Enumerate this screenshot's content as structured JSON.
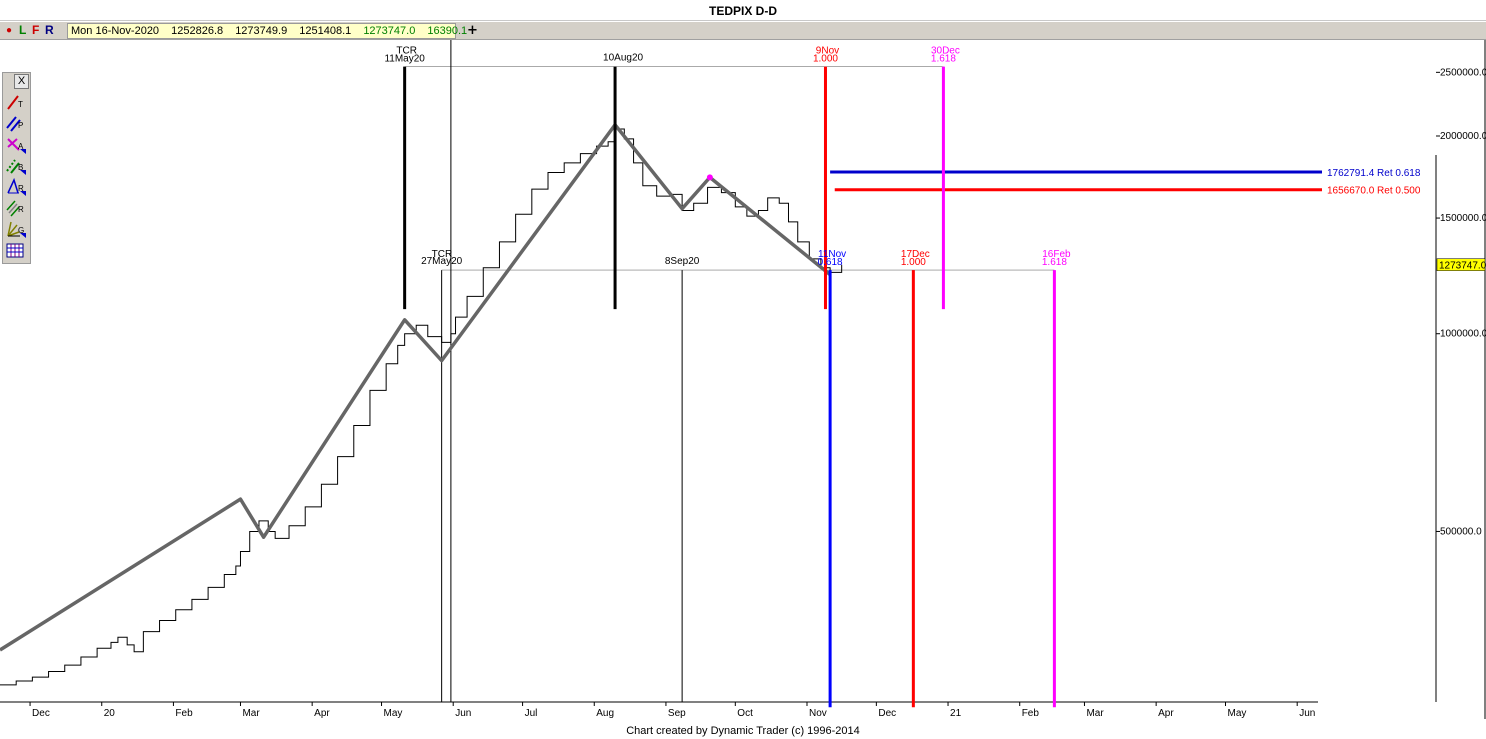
{
  "window": {
    "title": "TEDPIX D-D"
  },
  "toolbar": {
    "toggles": [
      {
        "label": "●",
        "color": "#cc0000"
      },
      {
        "label": "L",
        "color": "#008000"
      },
      {
        "label": "F",
        "color": "#cc0000"
      },
      {
        "label": "R",
        "color": "#000080"
      }
    ],
    "quote": {
      "date": "Mon 16-Nov-2020",
      "open": "1252826.8",
      "high": "1273749.9",
      "low": "1251408.1",
      "close": "1273747.0",
      "change": "16390.1"
    },
    "add_label": "+"
  },
  "toolbox": {
    "close_label": "X",
    "tools": [
      {
        "name": "trendline-tool-icon",
        "letter": "T",
        "color": "#cc0000"
      },
      {
        "name": "parallel-tool-icon",
        "letter": "P",
        "color": "#0000cc"
      },
      {
        "name": "alternate-price-projection-icon",
        "letter": "A",
        "color": "#cc00cc"
      },
      {
        "name": "price-band-tool-icon",
        "letter": "B",
        "color": "#008000"
      },
      {
        "name": "retracement-tool-icon",
        "letter": "R",
        "color": "#0000cc"
      },
      {
        "name": "ratio-tool-icon",
        "letter": "R",
        "color": "#008000"
      },
      {
        "name": "gann-tool-icon",
        "letter": "G",
        "color": "#808000"
      },
      {
        "name": "grid-tool-icon",
        "letter": "",
        "color": "#800080"
      }
    ]
  },
  "footer": {
    "credit": "Chart created by Dynamic Trader  (c) 1996-2014"
  },
  "chart_data": {
    "type": "line",
    "title": "TEDPIX D-D",
    "y_scale": "log",
    "ylim": [
      275000,
      2800000
    ],
    "xlim": [
      "2019-11-18",
      "2021-06-10"
    ],
    "grid": false,
    "x_ticks": [
      {
        "label": "Dec",
        "date": "2019-12-01"
      },
      {
        "label": "20",
        "date": "2020-01-01"
      },
      {
        "label": "Feb",
        "date": "2020-02-01"
      },
      {
        "label": "Mar",
        "date": "2020-03-01"
      },
      {
        "label": "Apr",
        "date": "2020-04-01"
      },
      {
        "label": "May",
        "date": "2020-05-01"
      },
      {
        "label": "Jun",
        "date": "2020-06-01"
      },
      {
        "label": "Jul",
        "date": "2020-07-01"
      },
      {
        "label": "Aug",
        "date": "2020-08-01"
      },
      {
        "label": "Sep",
        "date": "2020-09-01"
      },
      {
        "label": "Oct",
        "date": "2020-10-01"
      },
      {
        "label": "Nov",
        "date": "2020-11-01"
      },
      {
        "label": "Dec",
        "date": "2020-12-01"
      },
      {
        "label": "21",
        "date": "2021-01-01"
      },
      {
        "label": "Feb",
        "date": "2021-02-01"
      },
      {
        "label": "Mar",
        "date": "2021-03-01"
      },
      {
        "label": "Apr",
        "date": "2021-04-01"
      },
      {
        "label": "May",
        "date": "2021-05-01"
      },
      {
        "label": "Jun",
        "date": "2021-06-01"
      }
    ],
    "y_ticks": [
      {
        "label": "2500000.0",
        "value": 2500000
      },
      {
        "label": "2000000.0",
        "value": 2000000
      },
      {
        "label": "1500000.0",
        "value": 1500000
      },
      {
        "label": "1000000.0",
        "value": 1000000
      },
      {
        "label": "500000.0",
        "value": 500000
      }
    ],
    "last_price": {
      "label": "1273747.0",
      "value": 1273747
    },
    "series": [
      {
        "style": "step",
        "color": "#000000",
        "points": [
          [
            "2019-11-18",
            292000
          ],
          [
            "2019-11-25",
            296000
          ],
          [
            "2019-12-02",
            300000
          ],
          [
            "2019-12-09",
            306000
          ],
          [
            "2019-12-16",
            313000
          ],
          [
            "2019-12-23",
            322000
          ],
          [
            "2019-12-30",
            332000
          ],
          [
            "2020-01-05",
            339000
          ],
          [
            "2020-01-08",
            345000
          ],
          [
            "2020-01-12",
            336000
          ],
          [
            "2020-01-15",
            328000
          ],
          [
            "2020-01-19",
            352000
          ],
          [
            "2020-01-26",
            366000
          ],
          [
            "2020-02-02",
            380000
          ],
          [
            "2020-02-09",
            394000
          ],
          [
            "2020-02-16",
            411000
          ],
          [
            "2020-02-23",
            430000
          ],
          [
            "2020-02-28",
            443000
          ],
          [
            "2020-03-01",
            466000
          ],
          [
            "2020-03-05",
            500000
          ],
          [
            "2020-03-09",
            519000
          ],
          [
            "2020-03-13",
            500000
          ],
          [
            "2020-03-16",
            488000
          ],
          [
            "2020-03-22",
            510000
          ],
          [
            "2020-03-29",
            545000
          ],
          [
            "2020-04-05",
            590000
          ],
          [
            "2020-04-12",
            650000
          ],
          [
            "2020-04-19",
            725000
          ],
          [
            "2020-04-26",
            820000
          ],
          [
            "2020-05-03",
            900000
          ],
          [
            "2020-05-08",
            960000
          ],
          [
            "2020-05-11",
            1000000
          ],
          [
            "2020-05-16",
            1030000
          ],
          [
            "2020-05-21",
            990000
          ],
          [
            "2020-05-27",
            970000
          ],
          [
            "2020-05-31",
            1000000
          ],
          [
            "2020-06-02",
            1060000
          ],
          [
            "2020-06-07",
            1140000
          ],
          [
            "2020-06-14",
            1260000
          ],
          [
            "2020-06-21",
            1380000
          ],
          [
            "2020-06-28",
            1520000
          ],
          [
            "2020-07-05",
            1660000
          ],
          [
            "2020-07-12",
            1760000
          ],
          [
            "2020-07-19",
            1820000
          ],
          [
            "2020-07-26",
            1880000
          ],
          [
            "2020-08-02",
            1930000
          ],
          [
            "2020-08-07",
            1960000
          ],
          [
            "2020-08-10",
            2050000
          ],
          [
            "2020-08-14",
            1980000
          ],
          [
            "2020-08-18",
            1820000
          ],
          [
            "2020-08-22",
            1680000
          ],
          [
            "2020-08-28",
            1620000
          ],
          [
            "2020-09-03",
            1630000
          ],
          [
            "2020-09-08",
            1540000
          ],
          [
            "2020-09-13",
            1580000
          ],
          [
            "2020-09-19",
            1670000
          ],
          [
            "2020-09-25",
            1640000
          ],
          [
            "2020-10-01",
            1560000
          ],
          [
            "2020-10-06",
            1510000
          ],
          [
            "2020-10-11",
            1540000
          ],
          [
            "2020-10-15",
            1610000
          ],
          [
            "2020-10-20",
            1580000
          ],
          [
            "2020-10-24",
            1480000
          ],
          [
            "2020-10-28",
            1380000
          ],
          [
            "2020-11-02",
            1300000
          ],
          [
            "2020-11-07",
            1260000
          ],
          [
            "2020-11-11",
            1240000
          ],
          [
            "2020-11-16",
            1273747
          ]
        ]
      },
      {
        "style": "swing",
        "color": "#666666",
        "points": [
          [
            "2019-11-18",
            330000
          ],
          [
            "2020-03-01",
            560000
          ],
          [
            "2020-03-11",
            490000
          ],
          [
            "2020-05-11",
            1050000
          ],
          [
            "2020-05-27",
            910000
          ],
          [
            "2020-08-10",
            2080000
          ],
          [
            "2020-09-08",
            1550000
          ],
          [
            "2020-09-20",
            1730000
          ],
          [
            "2020-11-11",
            1230000
          ]
        ]
      }
    ],
    "annotations": {
      "vertical_bars": [
        {
          "date": "2020-05-11",
          "top": 2550000,
          "bottom": 1090000,
          "color": "#000000",
          "lines": [
            "TCR",
            "11May20"
          ]
        },
        {
          "date": "2020-08-10",
          "top": 2550000,
          "bottom": 1090000,
          "color": "#000000",
          "lines": [
            "10Aug20"
          ]
        },
        {
          "date": "2020-11-09",
          "top": 2550000,
          "bottom": 1090000,
          "color": "#ff0000",
          "lines": [
            "9Nov",
            "1.000"
          ]
        },
        {
          "date": "2020-12-30",
          "top": 2550000,
          "bottom": 1090000,
          "color": "#ff00ff",
          "lines": [
            "30Dec",
            "1.618"
          ]
        },
        {
          "date": "2020-11-11",
          "top": 1250000,
          "bottom": 270000,
          "color": "#0000ff",
          "lines": [
            "11Nov",
            "0.618"
          ]
        },
        {
          "date": "2020-12-17",
          "top": 1250000,
          "bottom": 270000,
          "color": "#ff0000",
          "lines": [
            "17Dec",
            "1.000"
          ]
        },
        {
          "date": "2021-02-16",
          "top": 1250000,
          "bottom": 270000,
          "color": "#ff00ff",
          "lines": [
            "16Feb",
            "1.618"
          ]
        }
      ],
      "thin_lines": [
        {
          "date": "2020-05-27",
          "top": 1250000,
          "lines": [
            "TCR",
            "27May20"
          ]
        },
        {
          "date": "2020-09-08",
          "top": 1250000,
          "lines": [
            "8Sep20"
          ]
        }
      ],
      "h_guides": [
        {
          "value": 2550000,
          "from": "2020-05-11",
          "to": "2020-12-30"
        },
        {
          "value": 1250000,
          "from": "2020-05-27",
          "to": "2021-02-16"
        }
      ],
      "price_levels": [
        {
          "value": 1762791.4,
          "label": "1762791.4 Ret 0.618",
          "color": "#0000cc",
          "from": "2020-11-11"
        },
        {
          "value": 1656670.0,
          "label": "1656670.0 Ret 0.500",
          "color": "#ff0000",
          "from": "2020-11-13"
        }
      ],
      "crosshair": {
        "date": "2020-05-31"
      },
      "marker": {
        "date": "2020-09-20",
        "value": 1730000,
        "color": "#ff00ff"
      }
    }
  }
}
